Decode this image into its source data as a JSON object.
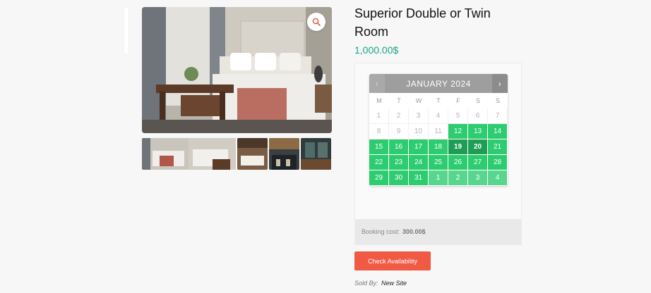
{
  "product": {
    "title": "Superior Double or Twin Room",
    "price": "1,000.00$"
  },
  "gallery": {
    "zoom_icon": "magnifier-icon",
    "thumbnails": [
      "room-thumb-1",
      "room-thumb-2",
      "room-thumb-3",
      "lobby-thumb-4",
      "bar-thumb-5"
    ]
  },
  "calendar": {
    "month_label": "JANUARY 2024",
    "prev_icon": "‹",
    "next_icon": "›",
    "weekdays": [
      "M",
      "T",
      "W",
      "T",
      "F",
      "S",
      "S"
    ],
    "days": [
      {
        "n": "1",
        "s": "off"
      },
      {
        "n": "2",
        "s": "off"
      },
      {
        "n": "3",
        "s": "off"
      },
      {
        "n": "4",
        "s": "off"
      },
      {
        "n": "5",
        "s": "off"
      },
      {
        "n": "6",
        "s": "off"
      },
      {
        "n": "7",
        "s": "off"
      },
      {
        "n": "8",
        "s": "off"
      },
      {
        "n": "9",
        "s": "off"
      },
      {
        "n": "10",
        "s": "off"
      },
      {
        "n": "11",
        "s": "off"
      },
      {
        "n": "12",
        "s": "avail"
      },
      {
        "n": "13",
        "s": "avail"
      },
      {
        "n": "14",
        "s": "avail"
      },
      {
        "n": "15",
        "s": "avail"
      },
      {
        "n": "16",
        "s": "avail"
      },
      {
        "n": "17",
        "s": "avail"
      },
      {
        "n": "18",
        "s": "avail"
      },
      {
        "n": "19",
        "s": "sel"
      },
      {
        "n": "20",
        "s": "sel"
      },
      {
        "n": "21",
        "s": "avail"
      },
      {
        "n": "22",
        "s": "avail"
      },
      {
        "n": "23",
        "s": "avail"
      },
      {
        "n": "24",
        "s": "avail"
      },
      {
        "n": "25",
        "s": "avail"
      },
      {
        "n": "26",
        "s": "avail"
      },
      {
        "n": "27",
        "s": "avail"
      },
      {
        "n": "28",
        "s": "avail"
      },
      {
        "n": "29",
        "s": "avail"
      },
      {
        "n": "30",
        "s": "avail"
      },
      {
        "n": "31",
        "s": "avail"
      },
      {
        "n": "1",
        "s": "next"
      },
      {
        "n": "2",
        "s": "next"
      },
      {
        "n": "3",
        "s": "next"
      },
      {
        "n": "4",
        "s": "next"
      }
    ]
  },
  "booking": {
    "cost_label": "Booking cost:",
    "cost_value": "300.00$",
    "check_button": "Check Availability"
  },
  "vendor": {
    "label": "Sold By:",
    "name": "New Site"
  },
  "colors": {
    "price": "#17a589",
    "available": "#2ecc71",
    "selected": "#1e9e55",
    "button": "#f05a45"
  }
}
